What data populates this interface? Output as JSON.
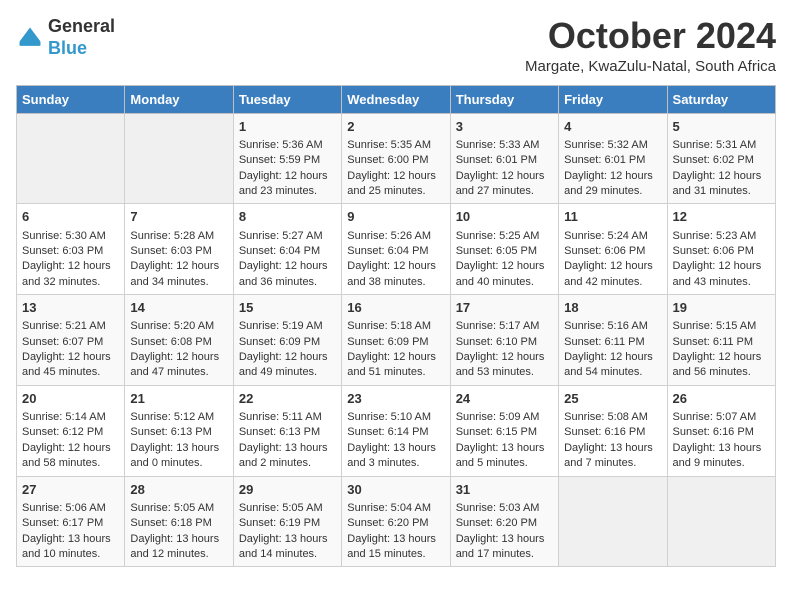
{
  "header": {
    "logo_general": "General",
    "logo_blue": "Blue",
    "title": "October 2024",
    "subtitle": "Margate, KwaZulu-Natal, South Africa"
  },
  "calendar": {
    "days_of_week": [
      "Sunday",
      "Monday",
      "Tuesday",
      "Wednesday",
      "Thursday",
      "Friday",
      "Saturday"
    ],
    "weeks": [
      [
        {
          "day": "",
          "content": ""
        },
        {
          "day": "",
          "content": ""
        },
        {
          "day": "1",
          "content": "Sunrise: 5:36 AM\nSunset: 5:59 PM\nDaylight: 12 hours\nand 23 minutes."
        },
        {
          "day": "2",
          "content": "Sunrise: 5:35 AM\nSunset: 6:00 PM\nDaylight: 12 hours\nand 25 minutes."
        },
        {
          "day": "3",
          "content": "Sunrise: 5:33 AM\nSunset: 6:01 PM\nDaylight: 12 hours\nand 27 minutes."
        },
        {
          "day": "4",
          "content": "Sunrise: 5:32 AM\nSunset: 6:01 PM\nDaylight: 12 hours\nand 29 minutes."
        },
        {
          "day": "5",
          "content": "Sunrise: 5:31 AM\nSunset: 6:02 PM\nDaylight: 12 hours\nand 31 minutes."
        }
      ],
      [
        {
          "day": "6",
          "content": "Sunrise: 5:30 AM\nSunset: 6:03 PM\nDaylight: 12 hours\nand 32 minutes."
        },
        {
          "day": "7",
          "content": "Sunrise: 5:28 AM\nSunset: 6:03 PM\nDaylight: 12 hours\nand 34 minutes."
        },
        {
          "day": "8",
          "content": "Sunrise: 5:27 AM\nSunset: 6:04 PM\nDaylight: 12 hours\nand 36 minutes."
        },
        {
          "day": "9",
          "content": "Sunrise: 5:26 AM\nSunset: 6:04 PM\nDaylight: 12 hours\nand 38 minutes."
        },
        {
          "day": "10",
          "content": "Sunrise: 5:25 AM\nSunset: 6:05 PM\nDaylight: 12 hours\nand 40 minutes."
        },
        {
          "day": "11",
          "content": "Sunrise: 5:24 AM\nSunset: 6:06 PM\nDaylight: 12 hours\nand 42 minutes."
        },
        {
          "day": "12",
          "content": "Sunrise: 5:23 AM\nSunset: 6:06 PM\nDaylight: 12 hours\nand 43 minutes."
        }
      ],
      [
        {
          "day": "13",
          "content": "Sunrise: 5:21 AM\nSunset: 6:07 PM\nDaylight: 12 hours\nand 45 minutes."
        },
        {
          "day": "14",
          "content": "Sunrise: 5:20 AM\nSunset: 6:08 PM\nDaylight: 12 hours\nand 47 minutes."
        },
        {
          "day": "15",
          "content": "Sunrise: 5:19 AM\nSunset: 6:09 PM\nDaylight: 12 hours\nand 49 minutes."
        },
        {
          "day": "16",
          "content": "Sunrise: 5:18 AM\nSunset: 6:09 PM\nDaylight: 12 hours\nand 51 minutes."
        },
        {
          "day": "17",
          "content": "Sunrise: 5:17 AM\nSunset: 6:10 PM\nDaylight: 12 hours\nand 53 minutes."
        },
        {
          "day": "18",
          "content": "Sunrise: 5:16 AM\nSunset: 6:11 PM\nDaylight: 12 hours\nand 54 minutes."
        },
        {
          "day": "19",
          "content": "Sunrise: 5:15 AM\nSunset: 6:11 PM\nDaylight: 12 hours\nand 56 minutes."
        }
      ],
      [
        {
          "day": "20",
          "content": "Sunrise: 5:14 AM\nSunset: 6:12 PM\nDaylight: 12 hours\nand 58 minutes."
        },
        {
          "day": "21",
          "content": "Sunrise: 5:12 AM\nSunset: 6:13 PM\nDaylight: 13 hours\nand 0 minutes."
        },
        {
          "day": "22",
          "content": "Sunrise: 5:11 AM\nSunset: 6:13 PM\nDaylight: 13 hours\nand 2 minutes."
        },
        {
          "day": "23",
          "content": "Sunrise: 5:10 AM\nSunset: 6:14 PM\nDaylight: 13 hours\nand 3 minutes."
        },
        {
          "day": "24",
          "content": "Sunrise: 5:09 AM\nSunset: 6:15 PM\nDaylight: 13 hours\nand 5 minutes."
        },
        {
          "day": "25",
          "content": "Sunrise: 5:08 AM\nSunset: 6:16 PM\nDaylight: 13 hours\nand 7 minutes."
        },
        {
          "day": "26",
          "content": "Sunrise: 5:07 AM\nSunset: 6:16 PM\nDaylight: 13 hours\nand 9 minutes."
        }
      ],
      [
        {
          "day": "27",
          "content": "Sunrise: 5:06 AM\nSunset: 6:17 PM\nDaylight: 13 hours\nand 10 minutes."
        },
        {
          "day": "28",
          "content": "Sunrise: 5:05 AM\nSunset: 6:18 PM\nDaylight: 13 hours\nand 12 minutes."
        },
        {
          "day": "29",
          "content": "Sunrise: 5:05 AM\nSunset: 6:19 PM\nDaylight: 13 hours\nand 14 minutes."
        },
        {
          "day": "30",
          "content": "Sunrise: 5:04 AM\nSunset: 6:20 PM\nDaylight: 13 hours\nand 15 minutes."
        },
        {
          "day": "31",
          "content": "Sunrise: 5:03 AM\nSunset: 6:20 PM\nDaylight: 13 hours\nand 17 minutes."
        },
        {
          "day": "",
          "content": ""
        },
        {
          "day": "",
          "content": ""
        }
      ]
    ]
  }
}
